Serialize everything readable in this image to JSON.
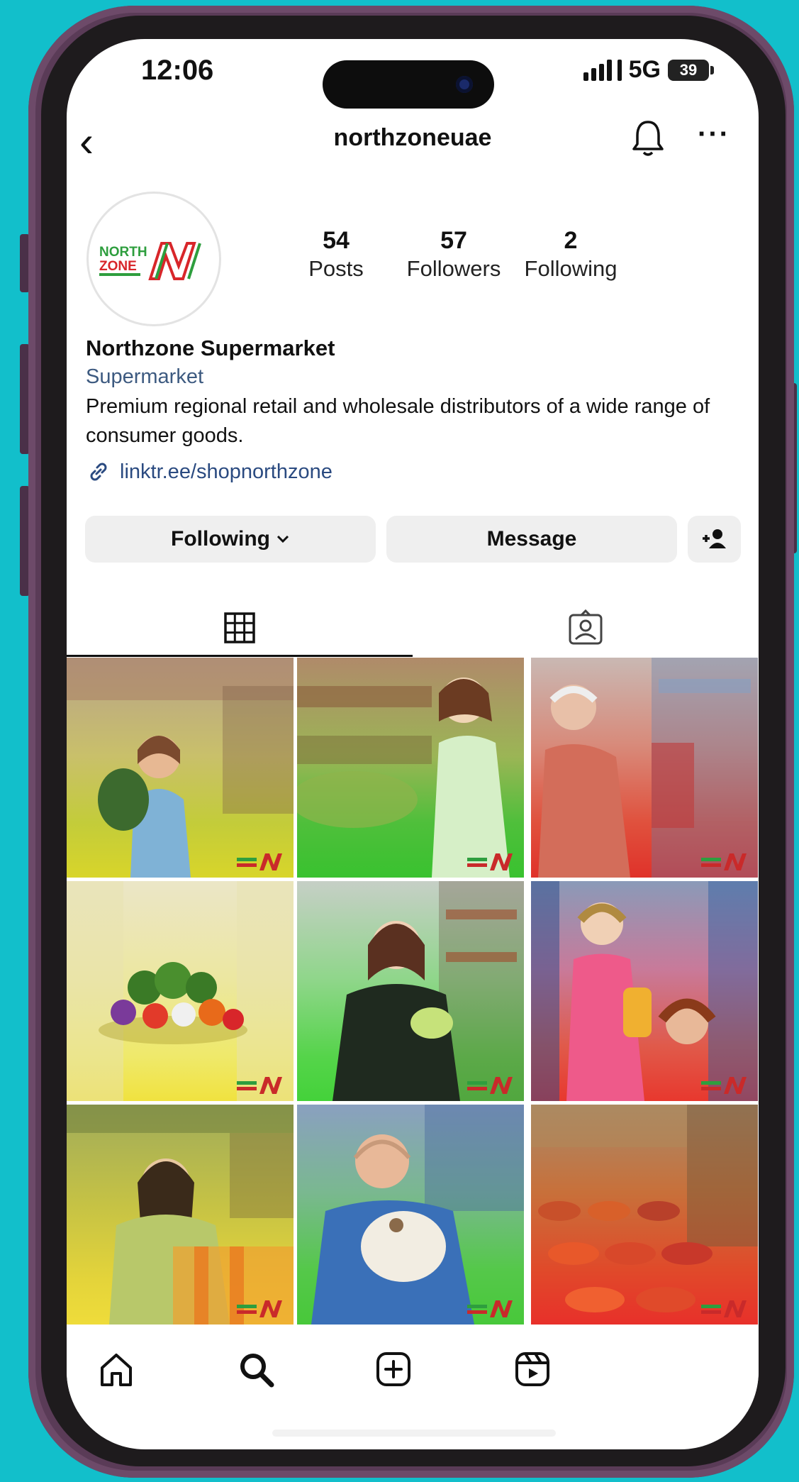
{
  "status_bar": {
    "time": "12:06",
    "network": "5G",
    "battery": "39"
  },
  "header": {
    "username": "northzoneuae",
    "back_icon": "chevron-left-icon",
    "bell_icon": "bell-icon",
    "more_icon": "more-horizontal-icon"
  },
  "profile": {
    "logo_text_line1": "NORTH",
    "logo_text_line2": "ZONE",
    "stats": [
      {
        "value": "54",
        "label": "Posts"
      },
      {
        "value": "57",
        "label": "Followers"
      },
      {
        "value": "2",
        "label": "Following"
      }
    ],
    "name": "Northzone Supermarket",
    "category": "Supermarket",
    "bio": "Premium regional retail and wholesale distributors of a wide range of consumer goods.",
    "link": "linktr.ee/shopnorthzone"
  },
  "actions": {
    "following_label": "Following",
    "message_label": "Message",
    "add_user_icon": "add-user-icon"
  },
  "tabs": [
    {
      "name": "grid",
      "icon": "grid-icon",
      "active": true
    },
    {
      "name": "tagged",
      "icon": "tagged-person-icon",
      "active": false
    }
  ],
  "nav": [
    {
      "name": "home",
      "icon": "home-icon"
    },
    {
      "name": "search",
      "icon": "search-icon"
    },
    {
      "name": "create",
      "icon": "plus-square-icon"
    },
    {
      "name": "reels",
      "icon": "reels-icon"
    }
  ],
  "colors": {
    "background": "#12bfcb",
    "brand_red": "#d8262a",
    "brand_green": "#2e9e3e",
    "link_blue": "#2a4a80",
    "button_gray": "#efefef"
  }
}
